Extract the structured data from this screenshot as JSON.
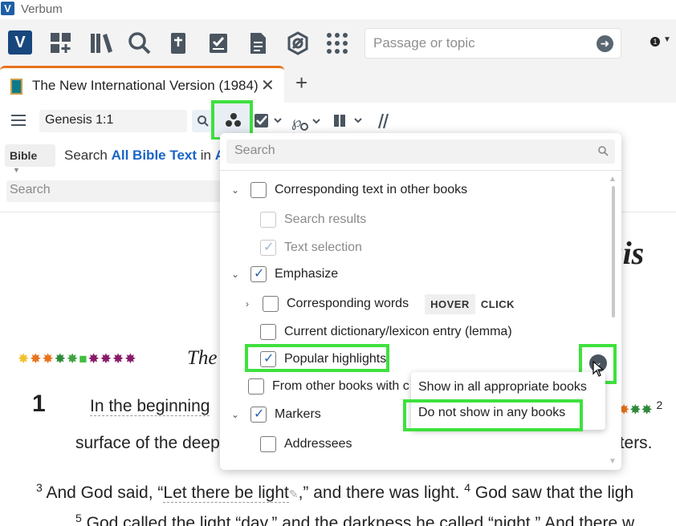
{
  "app": {
    "title": "Verbum",
    "logo_letter": "V"
  },
  "toolbar": {
    "search_placeholder": "Passage or topic",
    "notification_count": "1",
    "icons": [
      "add-layout-icon",
      "library-icon",
      "search-icon",
      "guides-icon",
      "tasks-icon",
      "documents-icon",
      "atlas-icon",
      "apps-icon"
    ]
  },
  "tab": {
    "title": "The New International Version (1984)",
    "close": "✕",
    "add": "+"
  },
  "panel": {
    "reference": "Genesis 1:1"
  },
  "search_bar": {
    "scope_dropdown": "Bible",
    "label_prefix": "Search",
    "label_link1": "All Bible Text",
    "label_in": "in",
    "label_link2": "All",
    "secondary_placeholder": "Search"
  },
  "bible": {
    "book_heading_fragment": "sis",
    "section_title_fragment": "The",
    "chapter": "1",
    "verse1_text": "In the beginning",
    "verse2_num": "2",
    "line2_left": "surface of the deep",
    "line2_right": "aters.",
    "verse3_num": "3",
    "verse3_text_a": "And God said, “",
    "verse3_link": "Let there be light",
    "verse3_text_b": ",” and there was light.",
    "verse4_num": "4",
    "verse4_text": "God saw that the ligh",
    "verse5_num": "5",
    "verse5_text": "God called the light “day,” and the darkness he called “night.” And there w"
  },
  "filter_panel": {
    "search_placeholder": "Search",
    "rows": [
      {
        "label": "Corresponding text in other books",
        "checked": false,
        "expander": "⌄"
      },
      {
        "label": "Search results",
        "checked": false,
        "disabled": true
      },
      {
        "label": "Text selection",
        "checked": true,
        "disabled": true
      },
      {
        "label": "Emphasize",
        "checked": true,
        "expander": "⌄"
      },
      {
        "label": "Corresponding words",
        "checked": false,
        "expander": "›"
      },
      {
        "label": "Current dictionary/lexicon entry (lemma)",
        "checked": false
      },
      {
        "label": "Popular highlights",
        "checked": true
      },
      {
        "label": "From other books with c",
        "checked": false
      },
      {
        "label": "Markers",
        "checked": true,
        "expander": "⌄"
      },
      {
        "label": "Addressees",
        "checked": false
      }
    ],
    "hover_chip": "HOVER",
    "click_chip": "CLICK"
  },
  "submenu": {
    "option1": "Show in all appropriate books",
    "option2": "Do not show in any books"
  },
  "colors": {
    "callout_green": "#3ee13e",
    "accent_orange": "#e8741c",
    "link_blue": "#1a64c8"
  }
}
